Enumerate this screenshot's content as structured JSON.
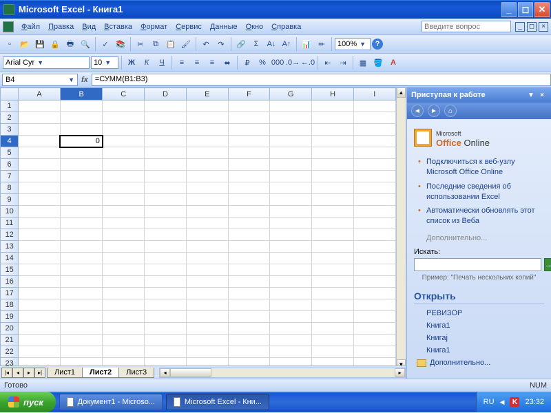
{
  "window": {
    "title": "Microsoft Excel - Книга1"
  },
  "menu": {
    "items": [
      "Файл",
      "Правка",
      "Вид",
      "Вставка",
      "Формат",
      "Сервис",
      "Данные",
      "Окно",
      "Справка"
    ],
    "ask_placeholder": "Введите вопрос"
  },
  "toolbar": {
    "zoom": "100%"
  },
  "formatting": {
    "font": "Arial Cyr",
    "size": "10"
  },
  "cell": {
    "name": "B4",
    "formula": "=СУММ(B1:B3)",
    "value": "0"
  },
  "columns": [
    "A",
    "B",
    "C",
    "D",
    "E",
    "F",
    "G",
    "H",
    "I"
  ],
  "rows": 23,
  "active": {
    "row": 4,
    "col": "B"
  },
  "sheets": {
    "tabs": [
      "Лист1",
      "Лист2",
      "Лист3"
    ],
    "active": 1
  },
  "taskpane": {
    "title": "Приступая к работе",
    "office_online": "Office Online",
    "office_prefix": "Microsoft",
    "links": [
      "Подключиться к веб-узлу Microsoft Office Online",
      "Последние сведения об использовании Excel",
      "Автоматически обновлять этот список из Веба"
    ],
    "more": "Дополнительно...",
    "search_label": "Искать:",
    "example": "Пример: \"Печать нескольких копий\"",
    "open_header": "Открыть",
    "open_items": [
      "РЕВИЗОР",
      "Книга1",
      "Книгај",
      "Книга1"
    ],
    "open_more": "Дополнительно..."
  },
  "status": {
    "ready": "Готово",
    "num": "NUM"
  },
  "taskbar": {
    "start": "пуск",
    "apps": [
      "Документ1 - Microso...",
      "Microsoft Excel - Кни..."
    ],
    "active_app": 1,
    "lang": "RU",
    "time": "23:32"
  }
}
